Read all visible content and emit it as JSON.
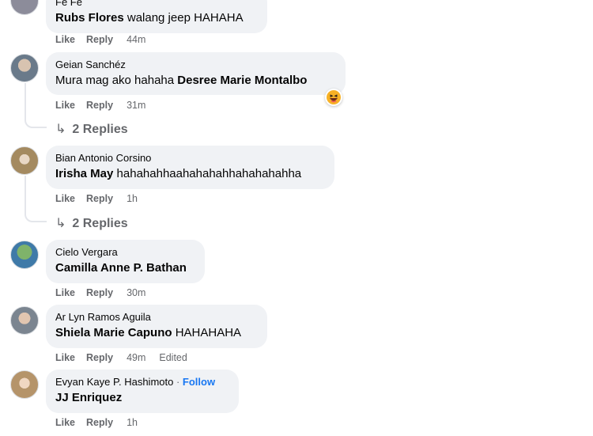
{
  "comments": [
    {
      "author": "Fe Fe",
      "tag": "Rubs Flores",
      "text": " walang jeep HAHAHA",
      "like": "Like",
      "reply": "Reply",
      "time": "44m"
    },
    {
      "author": "Geian Sanchéz",
      "text": "Mura mag ako hahaha ",
      "tag": "Desree Marie Montalbo",
      "like": "Like",
      "reply": "Reply",
      "time": "31m",
      "replies": "2 Replies",
      "reaction_icon": "haha-reaction-icon"
    },
    {
      "author": "Bian Antonio Corsino",
      "tag": "Irisha May",
      "text": " hahahahhaahahahahhahahahahha",
      "like": "Like",
      "reply": "Reply",
      "time": "1h",
      "replies": "2 Replies"
    },
    {
      "author": "Cielo Vergara",
      "tag": "Camilla Anne P. Bathan",
      "text": "",
      "like": "Like",
      "reply": "Reply",
      "time": "30m"
    },
    {
      "author": "Ar Lyn Ramos Aguila",
      "tag": "Shiela Marie Capuno",
      "text": " HAHAHAHA",
      "like": "Like",
      "reply": "Reply",
      "time": "49m",
      "edited": "Edited"
    },
    {
      "author": "Evyan Kaye P. Hashimoto",
      "follow_sep": " · ",
      "follow": "Follow",
      "tag": "JJ Enriquez",
      "text": "",
      "like": "Like",
      "reply": "Reply",
      "time": "1h"
    }
  ]
}
